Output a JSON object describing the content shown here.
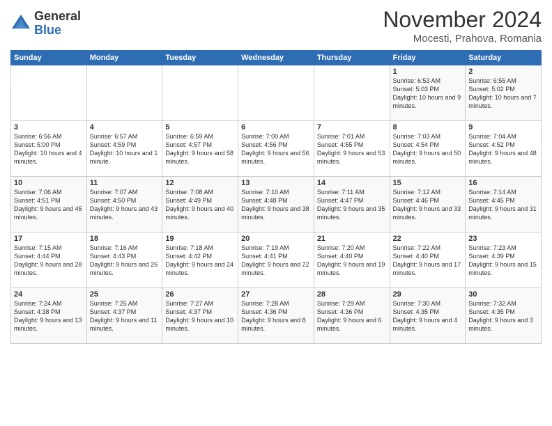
{
  "logo": {
    "general": "General",
    "blue": "Blue"
  },
  "title": "November 2024",
  "subtitle": "Mocesti, Prahova, Romania",
  "days_of_week": [
    "Sunday",
    "Monday",
    "Tuesday",
    "Wednesday",
    "Thursday",
    "Friday",
    "Saturday"
  ],
  "weeks": [
    [
      {
        "day": "",
        "info": ""
      },
      {
        "day": "",
        "info": ""
      },
      {
        "day": "",
        "info": ""
      },
      {
        "day": "",
        "info": ""
      },
      {
        "day": "",
        "info": ""
      },
      {
        "day": "1",
        "info": "Sunrise: 6:53 AM\nSunset: 5:03 PM\nDaylight: 10 hours and 9 minutes."
      },
      {
        "day": "2",
        "info": "Sunrise: 6:55 AM\nSunset: 5:02 PM\nDaylight: 10 hours and 7 minutes."
      }
    ],
    [
      {
        "day": "3",
        "info": "Sunrise: 6:56 AM\nSunset: 5:00 PM\nDaylight: 10 hours and 4 minutes."
      },
      {
        "day": "4",
        "info": "Sunrise: 6:57 AM\nSunset: 4:59 PM\nDaylight: 10 hours and 1 minute."
      },
      {
        "day": "5",
        "info": "Sunrise: 6:59 AM\nSunset: 4:57 PM\nDaylight: 9 hours and 58 minutes."
      },
      {
        "day": "6",
        "info": "Sunrise: 7:00 AM\nSunset: 4:56 PM\nDaylight: 9 hours and 56 minutes."
      },
      {
        "day": "7",
        "info": "Sunrise: 7:01 AM\nSunset: 4:55 PM\nDaylight: 9 hours and 53 minutes."
      },
      {
        "day": "8",
        "info": "Sunrise: 7:03 AM\nSunset: 4:54 PM\nDaylight: 9 hours and 50 minutes."
      },
      {
        "day": "9",
        "info": "Sunrise: 7:04 AM\nSunset: 4:52 PM\nDaylight: 9 hours and 48 minutes."
      }
    ],
    [
      {
        "day": "10",
        "info": "Sunrise: 7:06 AM\nSunset: 4:51 PM\nDaylight: 9 hours and 45 minutes."
      },
      {
        "day": "11",
        "info": "Sunrise: 7:07 AM\nSunset: 4:50 PM\nDaylight: 9 hours and 43 minutes."
      },
      {
        "day": "12",
        "info": "Sunrise: 7:08 AM\nSunset: 4:49 PM\nDaylight: 9 hours and 40 minutes."
      },
      {
        "day": "13",
        "info": "Sunrise: 7:10 AM\nSunset: 4:48 PM\nDaylight: 9 hours and 38 minutes."
      },
      {
        "day": "14",
        "info": "Sunrise: 7:11 AM\nSunset: 4:47 PM\nDaylight: 9 hours and 35 minutes."
      },
      {
        "day": "15",
        "info": "Sunrise: 7:12 AM\nSunset: 4:46 PM\nDaylight: 9 hours and 33 minutes."
      },
      {
        "day": "16",
        "info": "Sunrise: 7:14 AM\nSunset: 4:45 PM\nDaylight: 9 hours and 31 minutes."
      }
    ],
    [
      {
        "day": "17",
        "info": "Sunrise: 7:15 AM\nSunset: 4:44 PM\nDaylight: 9 hours and 28 minutes."
      },
      {
        "day": "18",
        "info": "Sunrise: 7:16 AM\nSunset: 4:43 PM\nDaylight: 9 hours and 26 minutes."
      },
      {
        "day": "19",
        "info": "Sunrise: 7:18 AM\nSunset: 4:42 PM\nDaylight: 9 hours and 24 minutes."
      },
      {
        "day": "20",
        "info": "Sunrise: 7:19 AM\nSunset: 4:41 PM\nDaylight: 9 hours and 22 minutes."
      },
      {
        "day": "21",
        "info": "Sunrise: 7:20 AM\nSunset: 4:40 PM\nDaylight: 9 hours and 19 minutes."
      },
      {
        "day": "22",
        "info": "Sunrise: 7:22 AM\nSunset: 4:40 PM\nDaylight: 9 hours and 17 minutes."
      },
      {
        "day": "23",
        "info": "Sunrise: 7:23 AM\nSunset: 4:39 PM\nDaylight: 9 hours and 15 minutes."
      }
    ],
    [
      {
        "day": "24",
        "info": "Sunrise: 7:24 AM\nSunset: 4:38 PM\nDaylight: 9 hours and 13 minutes."
      },
      {
        "day": "25",
        "info": "Sunrise: 7:25 AM\nSunset: 4:37 PM\nDaylight: 9 hours and 11 minutes."
      },
      {
        "day": "26",
        "info": "Sunrise: 7:27 AM\nSunset: 4:37 PM\nDaylight: 9 hours and 10 minutes."
      },
      {
        "day": "27",
        "info": "Sunrise: 7:28 AM\nSunset: 4:36 PM\nDaylight: 9 hours and 8 minutes."
      },
      {
        "day": "28",
        "info": "Sunrise: 7:29 AM\nSunset: 4:36 PM\nDaylight: 9 hours and 6 minutes."
      },
      {
        "day": "29",
        "info": "Sunrise: 7:30 AM\nSunset: 4:35 PM\nDaylight: 9 hours and 4 minutes."
      },
      {
        "day": "30",
        "info": "Sunrise: 7:32 AM\nSunset: 4:35 PM\nDaylight: 9 hours and 3 minutes."
      }
    ]
  ]
}
